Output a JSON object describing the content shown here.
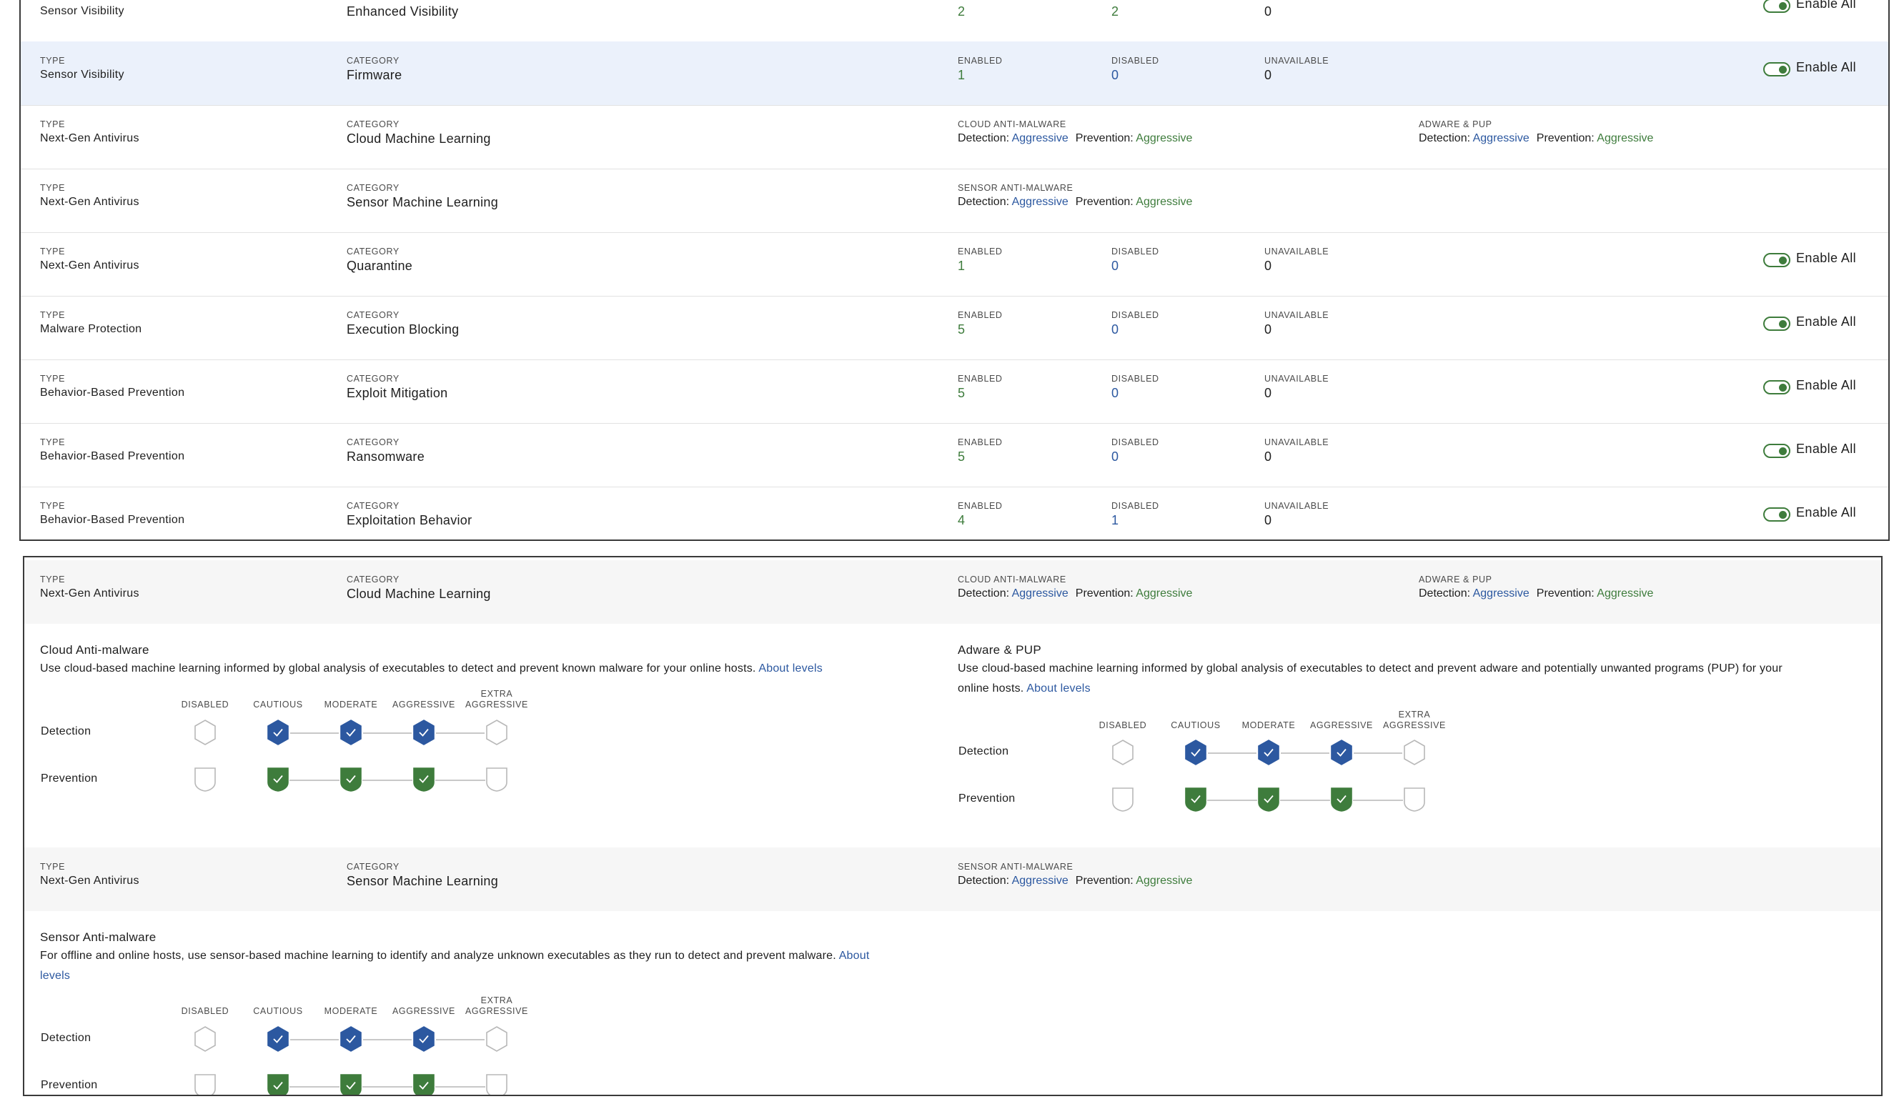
{
  "labels": {
    "type": "TYPE",
    "category": "CATEGORY",
    "enabled": "ENABLED",
    "disabled": "DISABLED",
    "unavailable": "UNAVAILABLE",
    "cloud_am": "CLOUD ANTI-MALWARE",
    "adware_pup": "ADWARE & PUP",
    "sensor_am": "SENSOR ANTI-MALWARE",
    "detection_prefix": "Detection:",
    "prevention_prefix": "Prevention:",
    "enable_all": "Enable All"
  },
  "policy_rows": [
    {
      "kind": "counts",
      "type": "Sensor Visibility",
      "category": "Enhanced Visibility",
      "enabled": "2",
      "disabled": "2",
      "unavailable": "0",
      "toggle": true,
      "partial_top": true
    },
    {
      "kind": "counts",
      "type": "Sensor Visibility",
      "category": "Firmware",
      "enabled": "1",
      "disabled": "0",
      "unavailable": "0",
      "toggle": true,
      "highlighted": true
    },
    {
      "kind": "ml2",
      "type": "Next-Gen Antivirus",
      "category": "Cloud Machine Learning",
      "col1_label": "CLOUD ANTI-MALWARE",
      "col1_detection": "Aggressive",
      "col1_prevention": "Aggressive",
      "col2_label": "ADWARE & PUP",
      "col2_detection": "Aggressive",
      "col2_prevention": "Aggressive"
    },
    {
      "kind": "ml1",
      "type": "Next-Gen Antivirus",
      "category": "Sensor Machine Learning",
      "col1_label": "SENSOR ANTI-MALWARE",
      "col1_detection": "Aggressive",
      "col1_prevention": "Aggressive"
    },
    {
      "kind": "counts",
      "type": "Next-Gen Antivirus",
      "category": "Quarantine",
      "enabled": "1",
      "disabled": "0",
      "unavailable": "0",
      "toggle": true
    },
    {
      "kind": "counts",
      "type": "Malware Protection",
      "category": "Execution Blocking",
      "enabled": "5",
      "disabled": "0",
      "unavailable": "0",
      "toggle": true
    },
    {
      "kind": "counts",
      "type": "Behavior-Based Prevention",
      "category": "Exploit Mitigation",
      "enabled": "5",
      "disabled": "0",
      "unavailable": "0",
      "toggle": true
    },
    {
      "kind": "counts",
      "type": "Behavior-Based Prevention",
      "category": "Ransomware",
      "enabled": "5",
      "disabled": "0",
      "unavailable": "0",
      "toggle": true
    },
    {
      "kind": "counts",
      "type": "Behavior-Based Prevention",
      "category": "Exploitation Behavior",
      "enabled": "4",
      "disabled": "1",
      "unavailable": "0",
      "toggle": true
    }
  ],
  "detail": {
    "row1": {
      "type": "Next-Gen Antivirus",
      "category": "Cloud Machine Learning",
      "col1_label": "CLOUD ANTI-MALWARE",
      "col1_detection": "Aggressive",
      "col1_prevention": "Aggressive",
      "col2_label": "ADWARE & PUP",
      "col2_detection": "Aggressive",
      "col2_prevention": "Aggressive"
    },
    "cloud_section": {
      "title": "Cloud Anti-malware",
      "desc": "Use cloud-based machine learning informed by global analysis of executables to detect and prevent known malware for your online hosts.",
      "link": "About levels"
    },
    "adware_section": {
      "title": "Adware & PUP",
      "desc_line1": "Use cloud-based machine learning informed by global analysis of executables to detect and prevent adware and potentially unwanted programs (PUP) for your",
      "desc_line2": "online hosts.",
      "link": "About levels"
    },
    "row2": {
      "type": "Next-Gen Antivirus",
      "category": "Sensor Machine Learning",
      "col1_label": "SENSOR ANTI-MALWARE",
      "col1_detection": "Aggressive",
      "col1_prevention": "Aggressive"
    },
    "sensor_section": {
      "title": "Sensor Anti-malware",
      "desc_line1": "For offline and online hosts, use sensor-based machine learning to identify and analyze unknown executables as they run to detect and prevent malware.",
      "link1": "About",
      "link2": "levels"
    },
    "levels": [
      "DISABLED",
      "CAUTIOUS",
      "MODERATE",
      "AGGRESSIVE",
      "EXTRA\nAGGRESSIVE"
    ],
    "row_labels": {
      "detection": "Detection",
      "prevention": "Prevention"
    },
    "selected_level_index": 3
  },
  "colors": {
    "blue": "#2c58a0",
    "green": "#3e7c3c",
    "highlight": "#ebf1fb",
    "gray_row": "#f6f6f6"
  }
}
